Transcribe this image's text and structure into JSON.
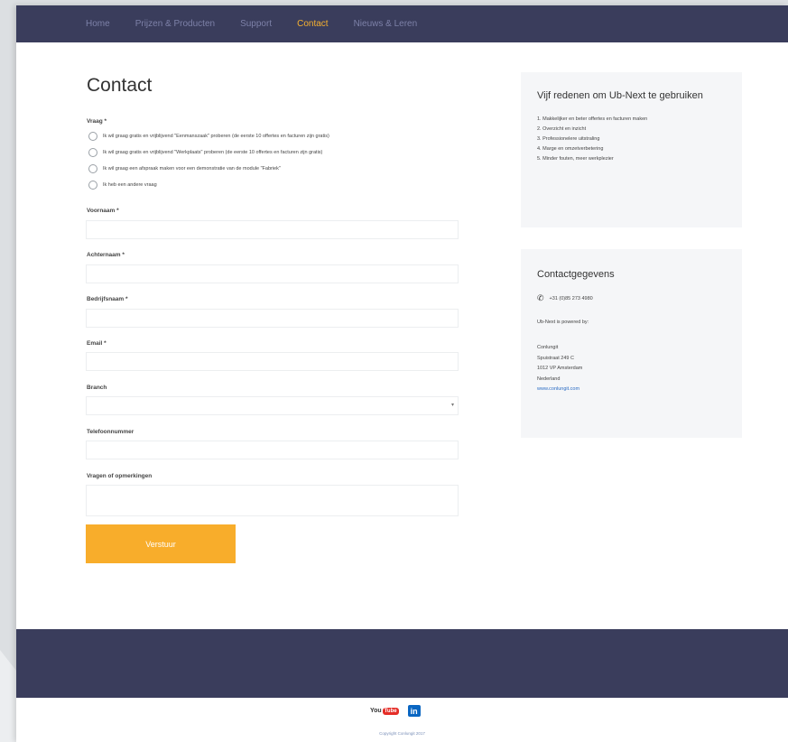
{
  "nav": {
    "items": [
      "Home",
      "Prijzen & Producten",
      "Support",
      "Contact",
      "Nieuws & Leren"
    ],
    "active": "Contact",
    "active_color": "#f6b130"
  },
  "form": {
    "title": "Contact",
    "vraag_label": "Vraag *",
    "radio_options": [
      "Ik wil graag gratis en vrijblijvend \"Eenmanszaak\" proberen (de eerste 10 offertes en facturen zijn gratis)",
      "Ik wil graag gratis en vrijblijvend \"Werkplaats\" proberen (de eerste 10 offertes en facturen zijn gratis)",
      "Ik wil graag een afspraak maken voor een demonstratie van de module \"Fabriek\"",
      "Ik heb een andere vraag"
    ],
    "fields": {
      "voornaam": "Voornaam *",
      "achternaam": "Achternaam *",
      "bedrijfsnaam": "Bedrijfsnaam *",
      "email": "Email *",
      "branch": "Branch",
      "telefoonnummer": "Telefoonnummer",
      "vragen": "Vragen of opmerkingen"
    },
    "submit_label": "Verstuur",
    "submit_color": "#f8ad2b"
  },
  "sidebar": {
    "reasons_title": "Vijf redenen om Ub-Next te gebruiken",
    "reasons": [
      "1. Makkelijker en beter offertes en facturen maken",
      "2. Overzicht en inzicht",
      "3. Professionelere uitstraling",
      "4. Marge en omzetverbetering",
      "5. Minder fouten, meer werkplezier"
    ],
    "contact_title": "Contactgegevens",
    "phone": "+31 (0)85 273 4980",
    "powered_by": "Ub-Next is powered by:",
    "address": [
      "Conlungit",
      "Spuistraat 249 C",
      "1012 VP Amsterdam",
      "Nederland"
    ],
    "website": "www.conlungit.com"
  },
  "footer": {
    "youtube_you": "You",
    "youtube_tube": "Tube",
    "linkedin": "in",
    "copyright": "Copyright Conlungit 2017",
    "dark_color": "#3a3d5c"
  }
}
